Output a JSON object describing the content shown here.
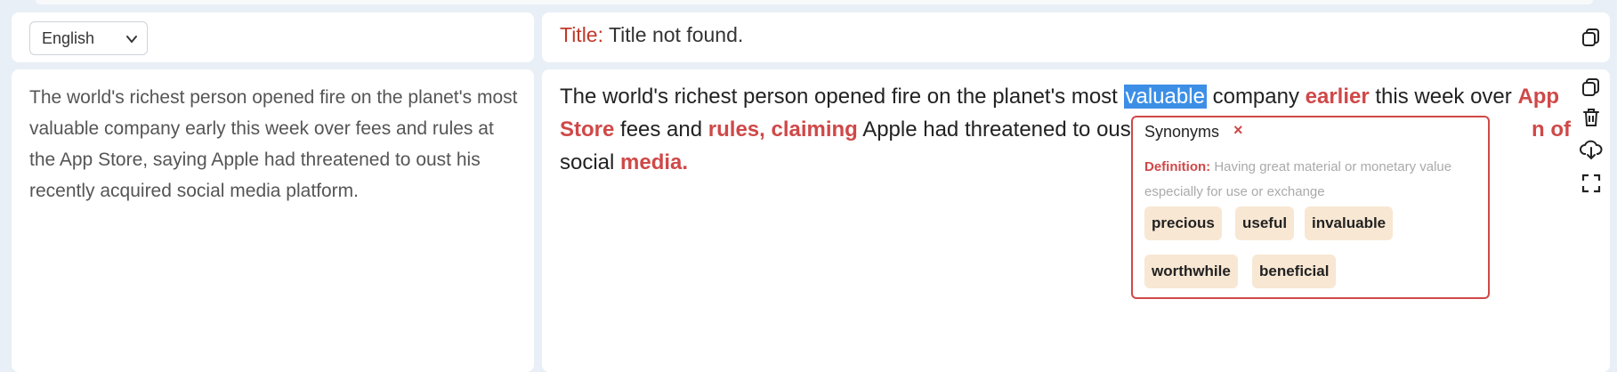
{
  "language": {
    "selected": "English"
  },
  "title": {
    "label": "Title:",
    "value": "Title not found."
  },
  "source": {
    "text": "The world's richest person opened fire on the planet's most valuable company early this week over fees and rules at the App Store, saying Apple had threatened to oust his recently acquired social media platform."
  },
  "result": {
    "line1": {
      "a": "The world's richest person opened fire on the planet's most ",
      "selected": "valuable",
      "b": " company ",
      "c": "earlier",
      "d": " this week over ",
      "e": "App"
    },
    "line2": {
      "a": "Store",
      "b": " fees and ",
      "c": "rules, claiming",
      "d": " Apple had threatened to ous",
      "e": "n of"
    },
    "line3": {
      "a": "social ",
      "b": "media."
    }
  },
  "synonyms": {
    "header": "Synonyms",
    "close": "×",
    "definition_label": "Definition:",
    "definition_text": "Having great material or monetary value especially for use or exchange",
    "items": [
      "precious",
      "useful",
      "invaluable",
      "worthwhile",
      "beneficial"
    ]
  },
  "colors": {
    "accent": "#d04848",
    "selection": "#3d8fe6",
    "chip": "#f8e7d3"
  },
  "icons": [
    "chevron-down-icon",
    "copy-icon",
    "copy-icon",
    "trash-icon",
    "cloud-download-icon",
    "fullscreen-icon"
  ]
}
